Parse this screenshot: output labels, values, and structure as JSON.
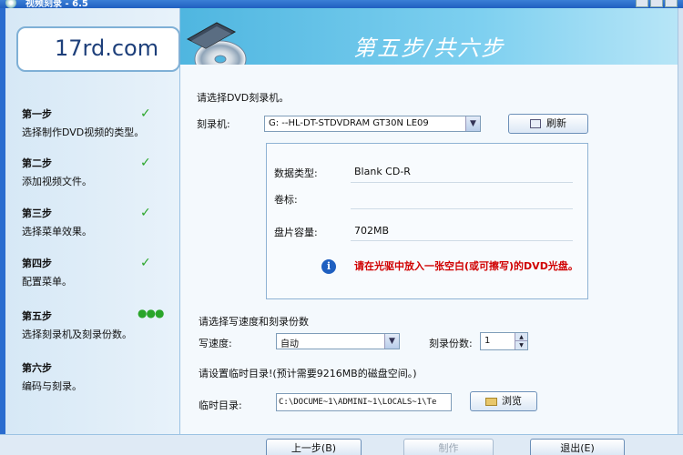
{
  "window": {
    "title": "视频刻录 - 6.5"
  },
  "logo": "17rd.com",
  "banner": {
    "heading": "第五步/共六步"
  },
  "steps": [
    {
      "name": "第一步",
      "desc": "选择制作DVD视频的类型。",
      "status": "done"
    },
    {
      "name": "第二步",
      "desc": "添加视频文件。",
      "status": "done"
    },
    {
      "name": "第三步",
      "desc": "选择菜单效果。",
      "status": "done"
    },
    {
      "name": "第四步",
      "desc": "配置菜单。",
      "status": "done"
    },
    {
      "name": "第五步",
      "desc": "选择刻录机及刻录份数。",
      "status": "current"
    },
    {
      "name": "第六步",
      "desc": "编码与刻录。",
      "status": "pending"
    }
  ],
  "markers": {
    "check": "✓",
    "dots": "●●●"
  },
  "content": {
    "select_prompt": "请选择DVD刻录机。",
    "burner_label": "刻录机:",
    "burner_value": "G:  --HL-DT-STDVDRAM GT30N    LE09",
    "refresh_button": "刷新",
    "disc_type_label": "数据类型:",
    "disc_type_value": "Blank CD-R",
    "volume_label": "卷标:",
    "volume_value": "",
    "capacity_label": "盘片容量:",
    "capacity_value": "702MB",
    "warning": "请在光驱中放入一张空白(或可擦写)的DVD光盘。",
    "speed_section": "请选择写速度和刻录份数",
    "speed_label": "写速度:",
    "speed_value": "自动",
    "copies_label": "刻录份数:",
    "copies_value": "1",
    "temp_prompt": "请设置临时目录!(预计需要9216MB的磁盘空间。)",
    "temp_label": "临时目录:",
    "temp_value": "C:\\DOCUME~1\\ADMINI~1\\LOCALS~1\\Te",
    "browse_button": "浏览"
  },
  "footer": {
    "back_button": "上一步(B)",
    "make_button": "制作",
    "exit_button": "退出(E)"
  },
  "colors": {
    "accent": "#1f5fc0",
    "warning": "#d00000",
    "check": "#2aa52a"
  }
}
